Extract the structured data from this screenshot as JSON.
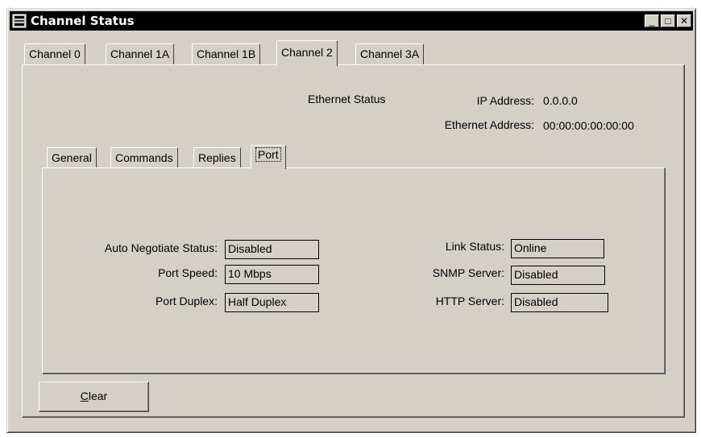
{
  "window": {
    "title": "Channel Status",
    "controls": {
      "minimize": "_",
      "maximize": "□",
      "close": "✕"
    }
  },
  "channel_tabs": [
    {
      "label": "Channel 0",
      "active": false
    },
    {
      "label": "Channel 1A",
      "active": false
    },
    {
      "label": "Channel 1B",
      "active": false
    },
    {
      "label": "Channel 2",
      "active": true
    },
    {
      "label": "Channel 3A",
      "active": false
    }
  ],
  "ethernet": {
    "heading": "Ethernet Status",
    "ip_label": "IP Address:",
    "ip_value": "0.0.0.0",
    "mac_label": "Ethernet Address:",
    "mac_value": "00:00:00:00:00:00"
  },
  "sub_tabs": [
    {
      "label": "General",
      "active": false
    },
    {
      "label": "Commands",
      "active": false
    },
    {
      "label": "Replies",
      "active": false
    },
    {
      "label": "Port",
      "active": true
    }
  ],
  "port": {
    "auto_negotiate_label": "Auto Negotiate Status:",
    "auto_negotiate_value": "Disabled",
    "port_speed_label": "Port Speed:",
    "port_speed_value": "10 Mbps",
    "port_duplex_label": "Port Duplex:",
    "port_duplex_value": "Half Duplex",
    "link_status_label": "Link Status:",
    "link_status_value": "Online",
    "snmp_label": "SNMP Server:",
    "snmp_value": "Disabled",
    "http_label": "HTTP Server:",
    "http_value": "Disabled"
  },
  "clear_button": {
    "mnemonic": "C",
    "rest": "lear"
  }
}
